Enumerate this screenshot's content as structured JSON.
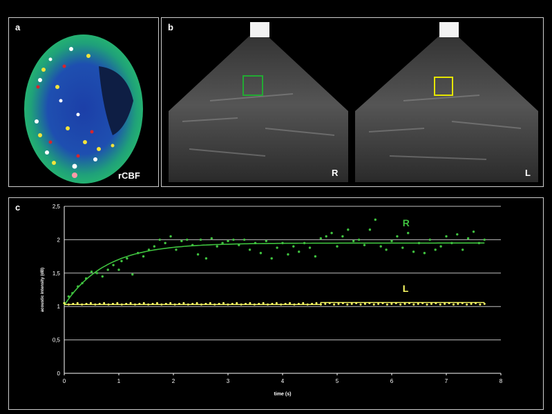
{
  "panels": {
    "a": {
      "letter": "a",
      "label": "rCBF"
    },
    "b": {
      "letter": "b",
      "left_label": "R",
      "right_label": "L"
    },
    "c": {
      "letter": "c"
    }
  },
  "colors": {
    "right_series": "#3fc23f",
    "left_series": "#ffff66",
    "roi_right": "#22aa33",
    "roi_left": "#e6e600",
    "grid": "#bfbfbf"
  },
  "chart_data": {
    "type": "scatter",
    "title": "",
    "xlabel": "time (s)",
    "ylabel": "acoustic intensity (dB)",
    "xlim": [
      0,
      8
    ],
    "ylim": [
      0,
      2.5
    ],
    "xticks": [
      0,
      1,
      2,
      3,
      4,
      5,
      6,
      7,
      8
    ],
    "yticks": [
      0,
      0.5,
      1,
      1.5,
      2,
      2.5
    ],
    "ytick_labels": [
      "0",
      "0,5",
      "1",
      "1,5",
      "2",
      "2,5"
    ],
    "grid": true,
    "series": [
      {
        "name": "R",
        "points": {
          "x": [
            0.0,
            0.08,
            0.15,
            0.25,
            0.33,
            0.4,
            0.5,
            0.6,
            0.7,
            0.8,
            0.9,
            1.0,
            1.05,
            1.15,
            1.25,
            1.35,
            1.45,
            1.55,
            1.65,
            1.75,
            1.85,
            1.95,
            2.05,
            2.15,
            2.25,
            2.35,
            2.45,
            2.5,
            2.6,
            2.7,
            2.8,
            2.9,
            3.0,
            3.1,
            3.2,
            3.3,
            3.4,
            3.5,
            3.6,
            3.7,
            3.8,
            3.9,
            4.0,
            4.1,
            4.2,
            4.3,
            4.4,
            4.5,
            4.6,
            4.7,
            4.8,
            4.9,
            5.0,
            5.1,
            5.2,
            5.3,
            5.4,
            5.5,
            5.6,
            5.7,
            5.8,
            5.9,
            6.0,
            6.1,
            6.2,
            6.3,
            6.4,
            6.5,
            6.6,
            6.7,
            6.8,
            6.9,
            7.0,
            7.1,
            7.2,
            7.3,
            7.4,
            7.5,
            7.6,
            7.7
          ],
          "y": [
            1.05,
            1.15,
            1.2,
            1.3,
            1.35,
            1.42,
            1.52,
            1.5,
            1.45,
            1.55,
            1.62,
            1.55,
            1.68,
            1.72,
            1.48,
            1.8,
            1.75,
            1.85,
            1.9,
            2.0,
            1.95,
            2.05,
            1.85,
            1.98,
            2.0,
            1.92,
            1.78,
            2.0,
            1.72,
            2.02,
            1.9,
            1.95,
            1.98,
            2.0,
            1.92,
            2.0,
            1.85,
            1.95,
            1.8,
            1.98,
            1.72,
            1.88,
            1.95,
            1.78,
            1.9,
            1.82,
            1.95,
            1.88,
            1.75,
            2.02,
            2.05,
            2.1,
            1.9,
            2.05,
            2.15,
            1.98,
            2.0,
            1.92,
            2.15,
            2.3,
            1.9,
            1.85,
            1.98,
            2.05,
            1.88,
            2.1,
            1.82,
            1.95,
            1.8,
            2.0,
            1.85,
            1.9,
            2.05,
            1.95,
            2.08,
            1.85,
            2.02,
            2.12,
            1.95,
            2.0
          ]
        },
        "fit_curve": {
          "model": "1.02 + 0.93*(1 - exp(-t/0.75))"
        }
      },
      {
        "name": "L",
        "points": {
          "constant_level": 1.04,
          "count": 96,
          "x_max": 7.7
        },
        "fit_curve": {
          "model": "step",
          "y_before": 1.03,
          "y_after": 1.06,
          "step_at": 4.7
        }
      }
    ]
  }
}
